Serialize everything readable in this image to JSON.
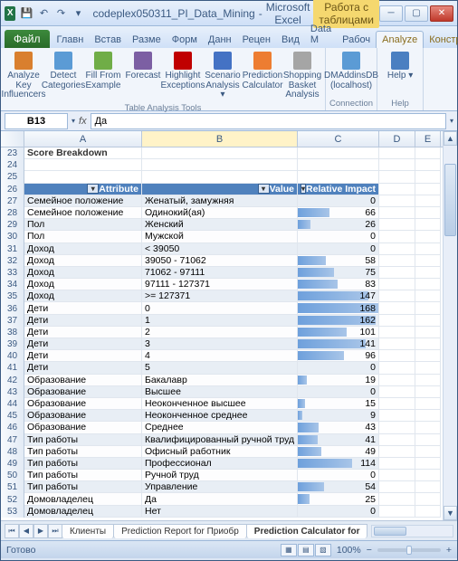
{
  "title": {
    "doc": "codeplex050311_PI_Data_Mining",
    "app": "Microsoft Excel",
    "context": "Работа с таблицами"
  },
  "menu": {
    "file": "Файл",
    "tabs": [
      "Главн",
      "Встав",
      "Разме",
      "Форм",
      "Данн",
      "Рецен",
      "Вид",
      "Data M",
      "Рабоч",
      "Analyze",
      "Конструктор"
    ],
    "activeIndex": 9
  },
  "ribbon": {
    "groups": [
      {
        "label": "Table Analysis Tools",
        "buttons": [
          {
            "name": "analyze-key-influencers",
            "label": "Analyze Key Influencers",
            "color": "#d97f2e"
          },
          {
            "name": "detect-categories",
            "label": "Detect Categories",
            "color": "#5b9bd5"
          },
          {
            "name": "fill-from-example",
            "label": "Fill From Example",
            "color": "#70ad47"
          },
          {
            "name": "forecast",
            "label": "Forecast",
            "color": "#7c5fa3"
          },
          {
            "name": "highlight-exceptions",
            "label": "Highlight Exceptions",
            "color": "#c00000"
          },
          {
            "name": "scenario-analysis",
            "label": "Scenario Analysis ▾",
            "color": "#4472c4"
          },
          {
            "name": "prediction-calculator",
            "label": "Prediction Calculator",
            "color": "#ed7d31"
          },
          {
            "name": "shopping-basket",
            "label": "Shopping Basket Analysis",
            "color": "#a5a5a5"
          }
        ]
      },
      {
        "label": "Connection",
        "buttons": [
          {
            "name": "connection",
            "label": "DMAddinsDB (localhost)",
            "color": "#5b9bd5"
          }
        ]
      },
      {
        "label": "Help",
        "buttons": [
          {
            "name": "help",
            "label": "Help ▾",
            "color": "#4a7fc1"
          }
        ]
      }
    ]
  },
  "namebox": {
    "cell": "B13",
    "fx": "fx",
    "formula": "Да"
  },
  "cols": [
    "A",
    "B",
    "C",
    "D",
    "E"
  ],
  "sheet": {
    "titleRow": {
      "num": 23,
      "text": "Score Breakdown"
    },
    "blankRows": [
      24,
      25
    ],
    "headerRow": {
      "num": 26,
      "a": "Attribute",
      "b": "Value",
      "c": "Relative Impact"
    },
    "data": [
      {
        "n": 27,
        "a": "Семейное положение",
        "b": "Женатый, замужняя",
        "c": 0
      },
      {
        "n": 28,
        "a": "Семейное положение",
        "b": "Одинокий(ая)",
        "c": 66
      },
      {
        "n": 29,
        "a": "Пол",
        "b": "Женский",
        "c": 26
      },
      {
        "n": 30,
        "a": "Пол",
        "b": "Мужской",
        "c": 0
      },
      {
        "n": 31,
        "a": "Доход",
        "b": "< 39050",
        "c": 0
      },
      {
        "n": 32,
        "a": "Доход",
        "b": "39050 - 71062",
        "c": 58
      },
      {
        "n": 33,
        "a": "Доход",
        "b": "71062 - 97111",
        "c": 75
      },
      {
        "n": 34,
        "a": "Доход",
        "b": "97111 - 127371",
        "c": 83
      },
      {
        "n": 35,
        "a": "Доход",
        "b": ">= 127371",
        "c": 147
      },
      {
        "n": 36,
        "a": "Дети",
        "b": "0",
        "c": 168
      },
      {
        "n": 37,
        "a": "Дети",
        "b": "1",
        "c": 162
      },
      {
        "n": 38,
        "a": "Дети",
        "b": "2",
        "c": 101
      },
      {
        "n": 39,
        "a": "Дети",
        "b": "3",
        "c": 141
      },
      {
        "n": 40,
        "a": "Дети",
        "b": "4",
        "c": 96
      },
      {
        "n": 41,
        "a": "Дети",
        "b": "5",
        "c": 0
      },
      {
        "n": 42,
        "a": "Образование",
        "b": "Бакалавр",
        "c": 19
      },
      {
        "n": 43,
        "a": "Образование",
        "b": "Высшее",
        "c": 0
      },
      {
        "n": 44,
        "a": "Образование",
        "b": "Неоконченное высшее",
        "c": 15
      },
      {
        "n": 45,
        "a": "Образование",
        "b": "Неоконченное среднее",
        "c": 9
      },
      {
        "n": 46,
        "a": "Образование",
        "b": "Среднее",
        "c": 43
      },
      {
        "n": 47,
        "a": "Тип работы",
        "b": "Квалифицированный ручной труд",
        "c": 41
      },
      {
        "n": 48,
        "a": "Тип работы",
        "b": "Офисный работник",
        "c": 49
      },
      {
        "n": 49,
        "a": "Тип работы",
        "b": "Профессионал",
        "c": 114
      },
      {
        "n": 50,
        "a": "Тип работы",
        "b": "Ручной труд",
        "c": 0
      },
      {
        "n": 51,
        "a": "Тип работы",
        "b": "Управление",
        "c": 54
      },
      {
        "n": 52,
        "a": "Домовладелец",
        "b": "Да",
        "c": 25
      },
      {
        "n": 53,
        "a": "Домовладелец",
        "b": "Нет",
        "c": 0
      }
    ],
    "maxImpact": 168
  },
  "sheetTabs": {
    "nav": [
      "⏮",
      "◀",
      "▶",
      "⏭"
    ],
    "tabs": [
      "Клиенты",
      "Prediction Report for Приобр",
      "Prediction Calculator for"
    ],
    "activeIndex": 2
  },
  "status": {
    "ready": "Готово",
    "zoom": "100%"
  }
}
